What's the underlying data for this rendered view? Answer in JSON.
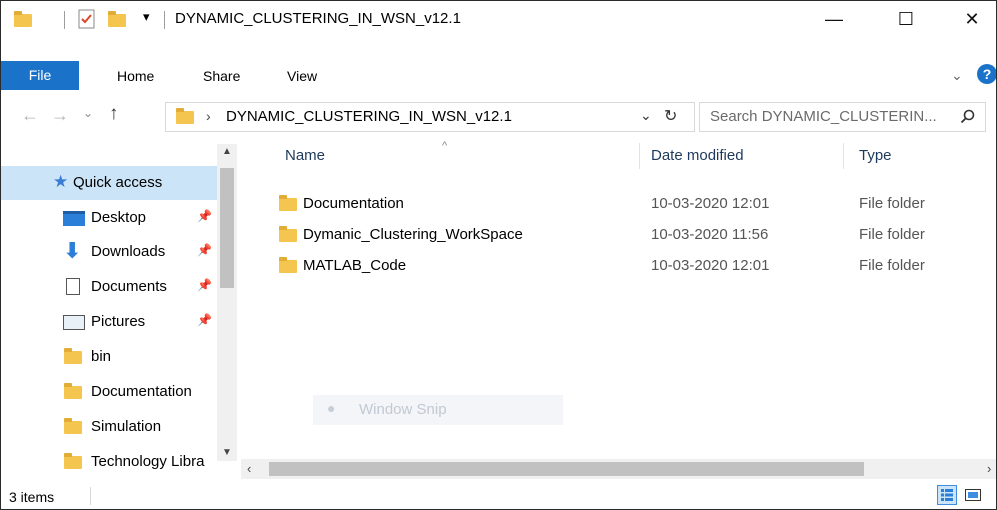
{
  "window": {
    "title": "DYNAMIC_CLUSTERING_IN_WSN_v12.1",
    "minimize_glyph": "—",
    "maximize_glyph": "☐",
    "close_glyph": "✕"
  },
  "ribbon": {
    "tabs": [
      "File",
      "Home",
      "Share",
      "View"
    ]
  },
  "address": {
    "path": "DYNAMIC_CLUSTERING_IN_WSN_v12.1",
    "search_placeholder": "Search DYNAMIC_CLUSTERIN..."
  },
  "sidebar": {
    "quick_access": "Quick access",
    "items": [
      {
        "label": "Desktop",
        "icon": "desktop-icon",
        "pinned": true
      },
      {
        "label": "Downloads",
        "icon": "download-icon",
        "pinned": true
      },
      {
        "label": "Documents",
        "icon": "documents-icon",
        "pinned": true
      },
      {
        "label": "Pictures",
        "icon": "pictures-icon",
        "pinned": true
      },
      {
        "label": "bin",
        "icon": "folder-icon",
        "pinned": false
      },
      {
        "label": "Documentation",
        "icon": "folder-icon",
        "pinned": false
      },
      {
        "label": "Simulation",
        "icon": "folder-icon",
        "pinned": false
      },
      {
        "label": "Technology Libra",
        "icon": "folder-icon",
        "pinned": false
      }
    ]
  },
  "file_list": {
    "columns": [
      "Name",
      "Date modified",
      "Type"
    ],
    "rows": [
      {
        "name": "Documentation",
        "date": "10-03-2020 12:01",
        "type": "File folder"
      },
      {
        "name": "Dymanic_Clustering_WorkSpace",
        "date": "10-03-2020 11:56",
        "type": "File folder"
      },
      {
        "name": "MATLAB_Code",
        "date": "10-03-2020 12:01",
        "type": "File folder"
      }
    ]
  },
  "overlay": {
    "label": "Window Snip"
  },
  "status_bar": {
    "count": "3 items"
  },
  "colors": {
    "accent": "#1a73c9",
    "folder": "#f4c54f",
    "help": "#1a73c9"
  }
}
